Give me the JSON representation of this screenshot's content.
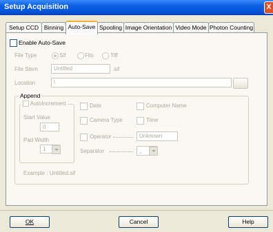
{
  "window": {
    "title": "Setup Acquisition",
    "close_label": "X"
  },
  "tabs": [
    {
      "label": "Setup CCD",
      "active": false
    },
    {
      "label": "Binning",
      "active": false
    },
    {
      "label": "Auto-Save",
      "active": true
    },
    {
      "label": "Spooling",
      "active": false
    },
    {
      "label": "Image Orientation",
      "active": false
    },
    {
      "label": "Video Mode",
      "active": false
    },
    {
      "label": "Photon Counting",
      "active": false
    }
  ],
  "autosave": {
    "enable_label": "Enable Auto-Save",
    "file_type_label": "File Type",
    "file_types": [
      "Sif",
      "Fits",
      "Tiff"
    ],
    "file_stem_label": "File Stem",
    "file_stem_value": "Untitled",
    "file_stem_ext": ".sif",
    "location_label": "Location",
    "location_value": "\\"
  },
  "append": {
    "group_label": "Append",
    "autoincrement_label": "AutoIncrement",
    "start_value_label": "Start Value",
    "start_value": "0",
    "pad_width_label": "Pad Width",
    "pad_width": "1",
    "date_label": "Date",
    "computer_name_label": "Computer Name",
    "camera_type_label": "Camera Type",
    "time_label": "Time",
    "operator_label": "Operator",
    "operator_value": "Unknown",
    "separator_label": "Separator",
    "separator_value": "_",
    "example_text": "Example : Untitled.sif"
  },
  "buttons": {
    "ok": "OK",
    "cancel": "Cancel",
    "help": "Help"
  }
}
